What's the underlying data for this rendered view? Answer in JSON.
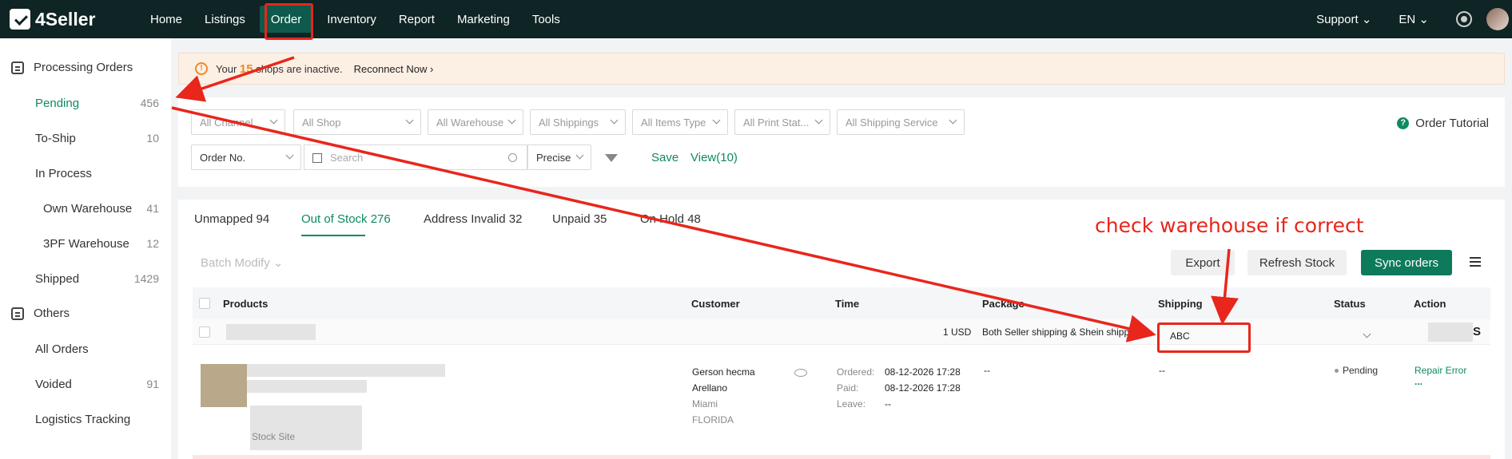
{
  "brand": {
    "name": "4Seller"
  },
  "nav": {
    "items": [
      "Home",
      "Listings",
      "Order",
      "Inventory",
      "Report",
      "Marketing",
      "Tools"
    ],
    "active": "Order",
    "support": "Support",
    "language": "EN"
  },
  "sidebar": {
    "groups": [
      {
        "label": "Processing Orders"
      },
      {
        "label": "Others"
      }
    ],
    "processing": [
      {
        "label": "Pending",
        "count": "456"
      },
      {
        "label": "To-Ship",
        "count": "10"
      },
      {
        "label": "In Process",
        "count": ""
      },
      {
        "label": "Own Warehouse",
        "count": "41"
      },
      {
        "label": "3PF Warehouse",
        "count": "12"
      },
      {
        "label": "Shipped",
        "count": "1429"
      }
    ],
    "others": [
      {
        "label": "All Orders",
        "count": ""
      },
      {
        "label": "Voided",
        "count": "91"
      },
      {
        "label": "Logistics Tracking",
        "count": ""
      }
    ]
  },
  "alert": {
    "prefix": "Your",
    "count": "15",
    "suffix": "shops are inactive.",
    "action": "Reconnect Now ›"
  },
  "filters": {
    "channel": "All Channel",
    "shop": "All Shop",
    "warehouse": "All Warehouse",
    "shippings": "All Shippings",
    "items_type": "All Items Type",
    "print_status": "All Print Stat...",
    "shipping_service": "All Shipping Service",
    "order_no": "Order No.",
    "search_placeholder": "Search",
    "match_mode": "Precise",
    "save": "Save",
    "views": "View(10)",
    "tutorial": "Order Tutorial"
  },
  "tabs": [
    {
      "label": "Unmapped 94"
    },
    {
      "label": "Out of Stock 276"
    },
    {
      "label": "Address Invalid 32"
    },
    {
      "label": "Unpaid 35"
    },
    {
      "label": "On Hold 48"
    }
  ],
  "toolbar": {
    "batch_modify": "Batch Modify",
    "export": "Export",
    "refresh_stock": "Refresh Stock",
    "sync_orders": "Sync orders"
  },
  "table": {
    "headers": [
      "Products",
      "Customer",
      "Time",
      "Package",
      "Shipping",
      "Status",
      "Action"
    ],
    "group_row": {
      "amount": "1 USD",
      "package": "Both Seller shipping & Shein shippi...",
      "shipping": "ABC",
      "action_tail": "S"
    },
    "row": {
      "stock_label": "Stock Site",
      "customer_name_1": "Gerson hecma",
      "customer_name_2": "Arellano",
      "city": "Miami",
      "state": "FLORIDA",
      "ordered_label": "Ordered:",
      "ordered": "08-12-2026 17:28",
      "paid_label": "Paid:",
      "paid": "08-12-2026 17:28",
      "leave_label": "Leave:",
      "leave": "--",
      "package": "--",
      "shipping": "--",
      "status": "Pending",
      "action": "Repair Error",
      "more": "..."
    }
  },
  "annotation": {
    "text": "check warehouse if correct",
    "color": "#e8261b"
  },
  "colors": {
    "topbar": "#0f2424",
    "accent": "#0e8a5f",
    "primary_button": "#0e7a5c",
    "warning": "#f08a24"
  }
}
